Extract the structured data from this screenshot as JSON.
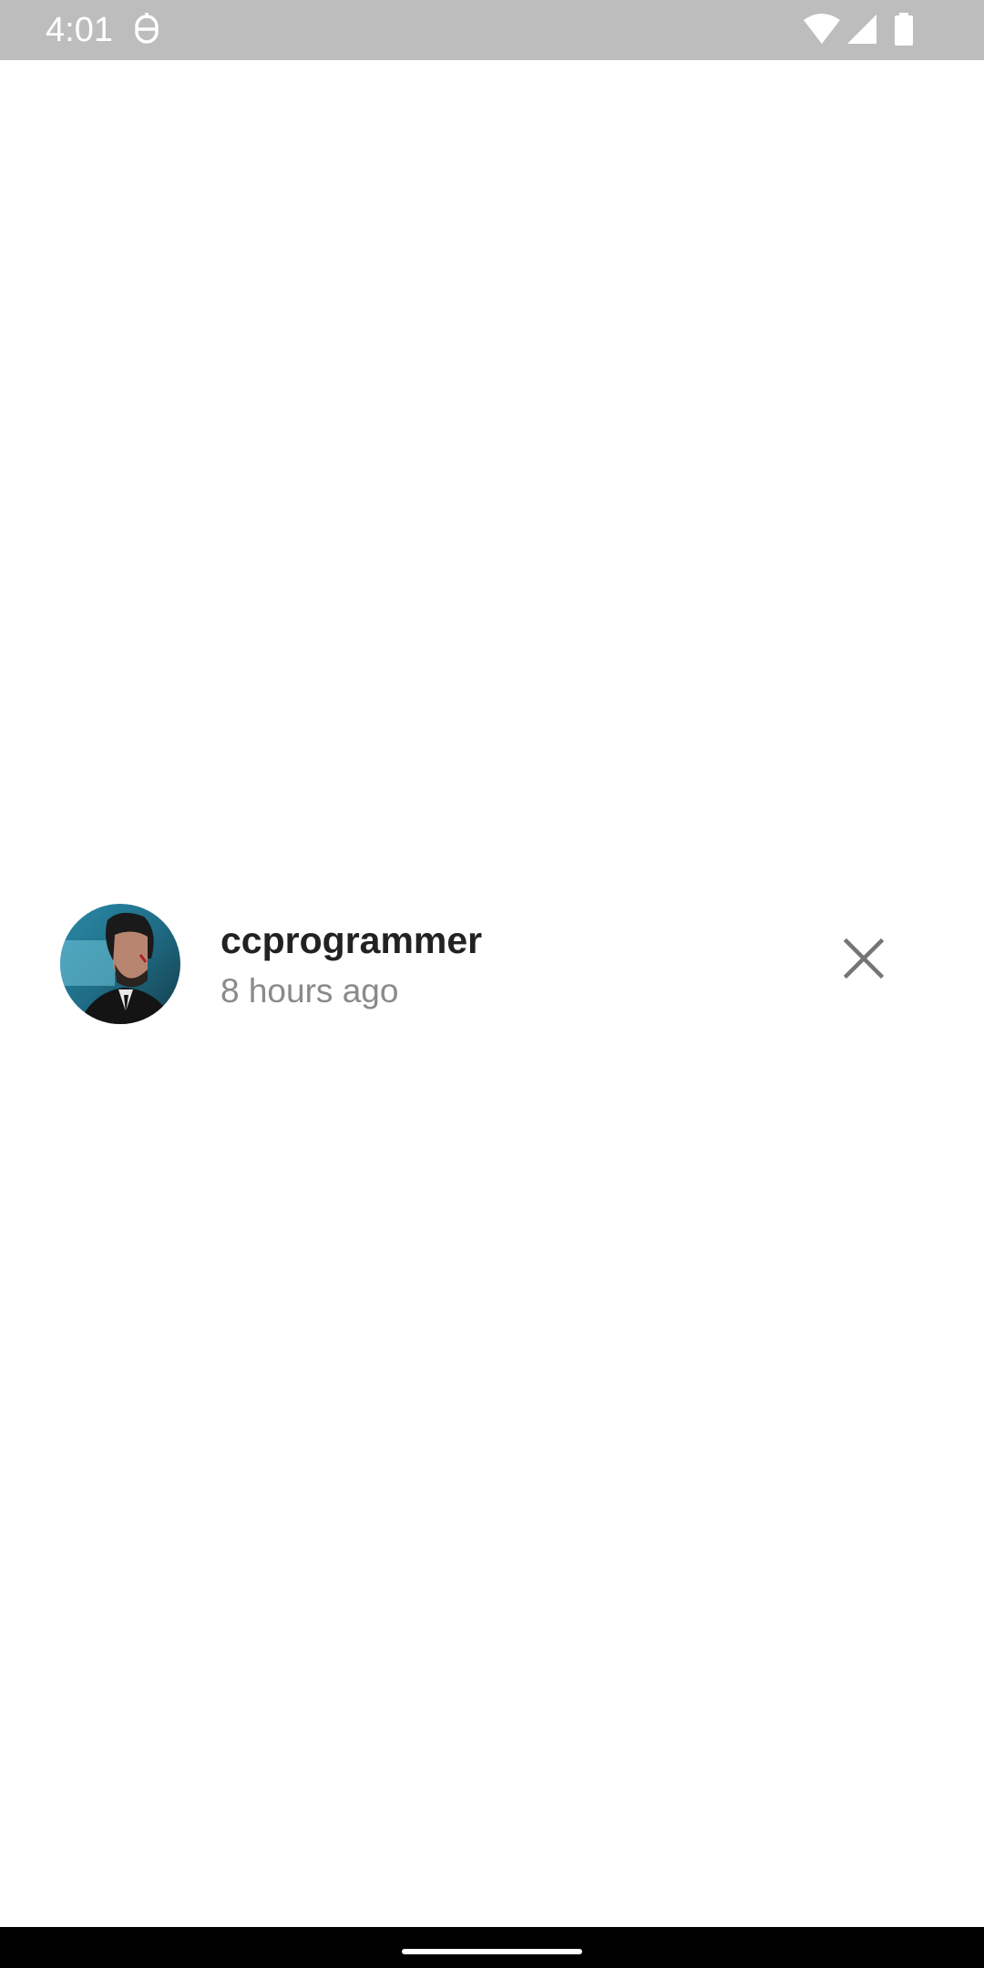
{
  "status_bar": {
    "time": "4:01",
    "icons": [
      "notification-app-icon",
      "wifi-icon",
      "cell-signal-icon",
      "battery-icon"
    ]
  },
  "story": {
    "username": "ccprogrammer",
    "timestamp": "8 hours ago",
    "close_icon": "close-icon"
  },
  "colors": {
    "status_bar_bg": "#bdbdbd",
    "username": "#222222",
    "timestamp": "#8a8a8a",
    "close_icon": "#757575",
    "nav_bar_bg": "#000000"
  }
}
